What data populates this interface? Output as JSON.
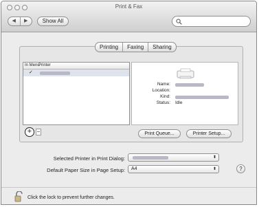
{
  "window": {
    "title": "Print & Fax"
  },
  "toolbar": {
    "back_label": "◀",
    "forward_label": "▶",
    "show_all": "Show All",
    "search_placeholder": ""
  },
  "tabs": [
    {
      "label": "Printing"
    },
    {
      "label": "Faxing"
    },
    {
      "label": "Sharing"
    }
  ],
  "printer_list": {
    "col_in_menu": "In Menu",
    "col_printer": "Printer",
    "rows": [
      {
        "checked": "✓",
        "name": ""
      }
    ]
  },
  "details": {
    "name_label": "Name:",
    "location_label": "Location:",
    "kind_label": "Kind:",
    "status_label": "Status:",
    "status_value": "Idle"
  },
  "buttons": {
    "add": "+",
    "remove": "−",
    "print_queue": "Print Queue...",
    "printer_setup": "Printer Setup..."
  },
  "settings": {
    "selected_printer_label": "Selected Printer in Print Dialog:",
    "selected_printer_value": "",
    "paper_size_label": "Default Paper Size in Page Setup:",
    "paper_size_value": "A4",
    "help": "?"
  },
  "lock": {
    "text": "Click the lock to prevent further changes."
  }
}
